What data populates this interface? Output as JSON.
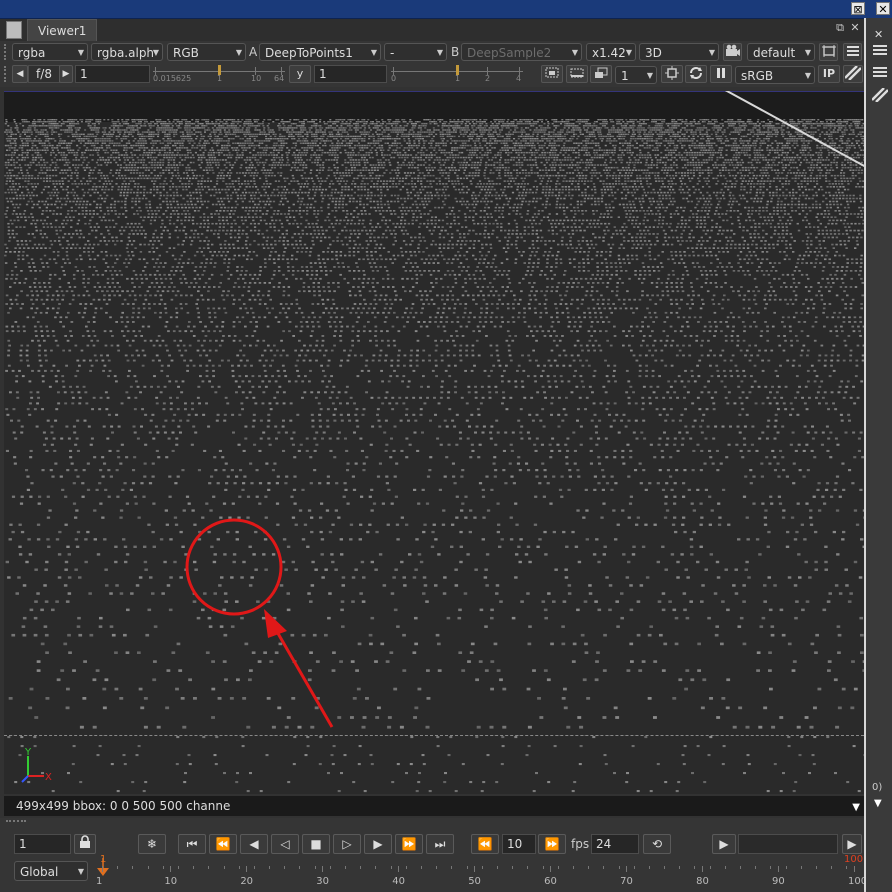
{
  "window": {
    "tab_label": "Viewer1",
    "title_buttons": [
      "⊠",
      "✕"
    ]
  },
  "toolbar1": {
    "channels": "rgba",
    "alpha_channel": "rgba.alph",
    "display_channel": "RGB",
    "input_a_label": "A",
    "input_a": "DeepToPoints1",
    "operation": "-",
    "input_b_label": "B",
    "input_b": "DeepSample2",
    "zoom": "x1.42",
    "view_mode": "3D",
    "camera": "default"
  },
  "toolbar2": {
    "fstop": "f/8",
    "gain": "1",
    "gain_ticks": [
      "0.015625",
      "1",
      "10",
      "64"
    ],
    "gamma_label": "y",
    "gamma": "1",
    "gamma_ticks": [
      "0",
      "1",
      "2",
      "4"
    ],
    "proxy": "1",
    "lut": "sRGB",
    "ip_label": "IP"
  },
  "info_bar": {
    "text": "499x499 bbox: 0 0 500 500 channe"
  },
  "axis": {
    "y": "Y",
    "x": "X"
  },
  "annotation": {
    "color": "#e01818"
  },
  "timeline": {
    "frame": "1",
    "step": "10",
    "fps_label": "fps",
    "fps": "24",
    "range_mode": "Global",
    "ruler_labels": [
      "1",
      "10",
      "20",
      "30",
      "40",
      "50",
      "60",
      "70",
      "80",
      "90",
      "100"
    ],
    "end_frame": "100",
    "start_marker": "1"
  },
  "right_strip": {
    "label": "0)"
  }
}
